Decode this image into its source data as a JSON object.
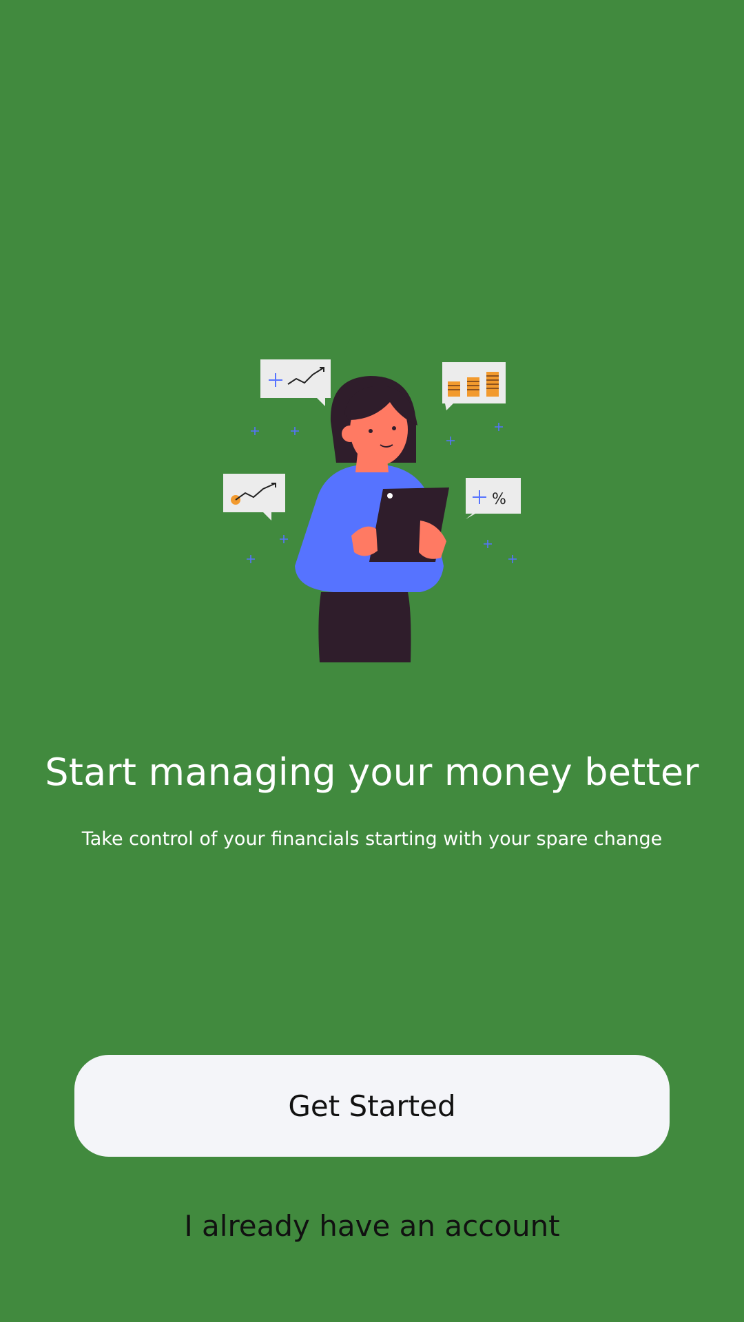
{
  "onboarding": {
    "illustration_icon": "woman-with-tablet-finance-illustration",
    "title": "Start managing your money better",
    "subtitle": "Take control of your financials starting with your spare change",
    "primary_button_label": "Get Started",
    "secondary_link_label": "I already have an account"
  },
  "colors": {
    "background": "#418a3e",
    "button_bg": "#f4f5f9",
    "title_text": "#ffffff",
    "button_text": "#111111",
    "accent_blue": "#5673ff",
    "accent_orange": "#f29a2e"
  }
}
